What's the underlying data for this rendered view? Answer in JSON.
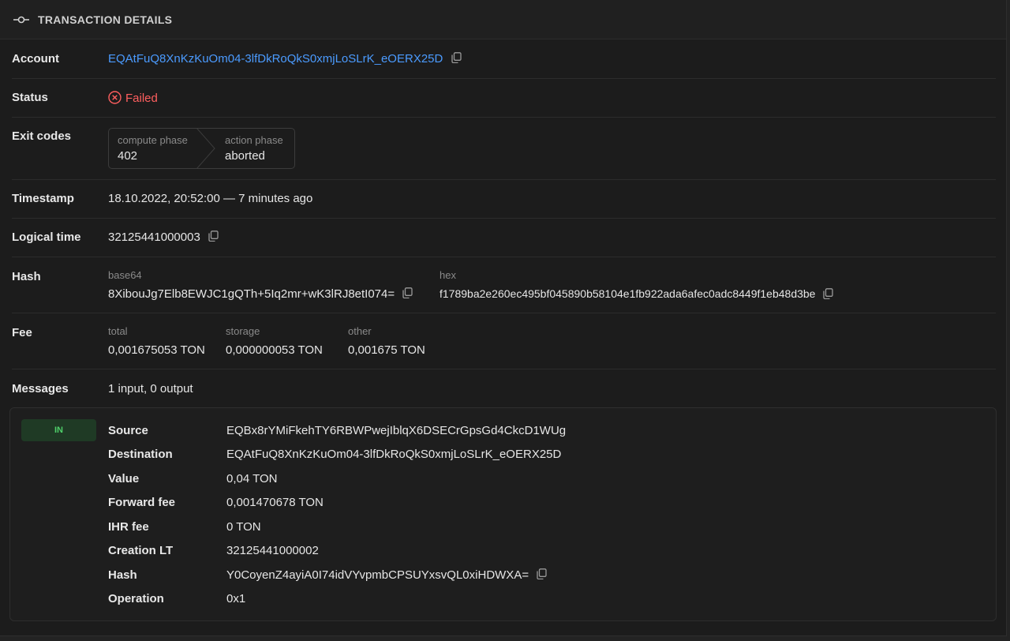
{
  "header": {
    "title": "TRANSACTION DETAILS"
  },
  "account": {
    "label": "Account",
    "value": "EQAtFuQ8XnKzKuOm04-3lfDkRoQkS0xmjLoSLrK_eOERX25D"
  },
  "status": {
    "label": "Status",
    "value": "Failed"
  },
  "exit_codes": {
    "label": "Exit codes",
    "compute_label": "compute phase",
    "compute_value": "402",
    "action_label": "action phase",
    "action_value": "aborted"
  },
  "timestamp": {
    "label": "Timestamp",
    "value": "18.10.2022, 20:52:00 — 7 minutes ago"
  },
  "logical_time": {
    "label": "Logical time",
    "value": "32125441000003"
  },
  "hash": {
    "label": "Hash",
    "base64_label": "base64",
    "base64_value": "8XibouJg7Elb8EWJC1gQTh+5Iq2mr+wK3lRJ8etI074=",
    "hex_label": "hex",
    "hex_value": "f1789ba2e260ec495bf045890b58104e1fb922ada6afec0adc8449f1eb48d3be"
  },
  "fee": {
    "label": "Fee",
    "total_label": "total",
    "total_value": "0,001675053 TON",
    "storage_label": "storage",
    "storage_value": "0,000000053 TON",
    "other_label": "other",
    "other_value": "0,001675 TON"
  },
  "messages": {
    "label": "Messages",
    "summary": "1 input, 0 output",
    "items": [
      {
        "direction": "IN",
        "source_label": "Source",
        "source": "EQBx8rYMiFkehTY6RBWPwejIblqX6DSECrGpsGd4CkcD1WUg",
        "destination_label": "Destination",
        "destination": "EQAtFuQ8XnKzKuOm04-3lfDkRoQkS0xmjLoSLrK_eOERX25D",
        "value_label": "Value",
        "value": "0,04 TON",
        "forward_fee_label": "Forward fee",
        "forward_fee": "0,001470678 TON",
        "ihr_fee_label": "IHR fee",
        "ihr_fee": "0 TON",
        "creation_lt_label": "Creation LT",
        "creation_lt": "32125441000002",
        "hash_label": "Hash",
        "hash": "Y0CoyenZ4ayiA0I74idVYvpmbCPSUYxsvQL0xiHDWXA=",
        "operation_label": "Operation",
        "operation": "0x1"
      }
    ]
  },
  "colors": {
    "link": "#4b9bff",
    "failed": "#ff5f5f",
    "in_badge": "#4fd06a"
  }
}
